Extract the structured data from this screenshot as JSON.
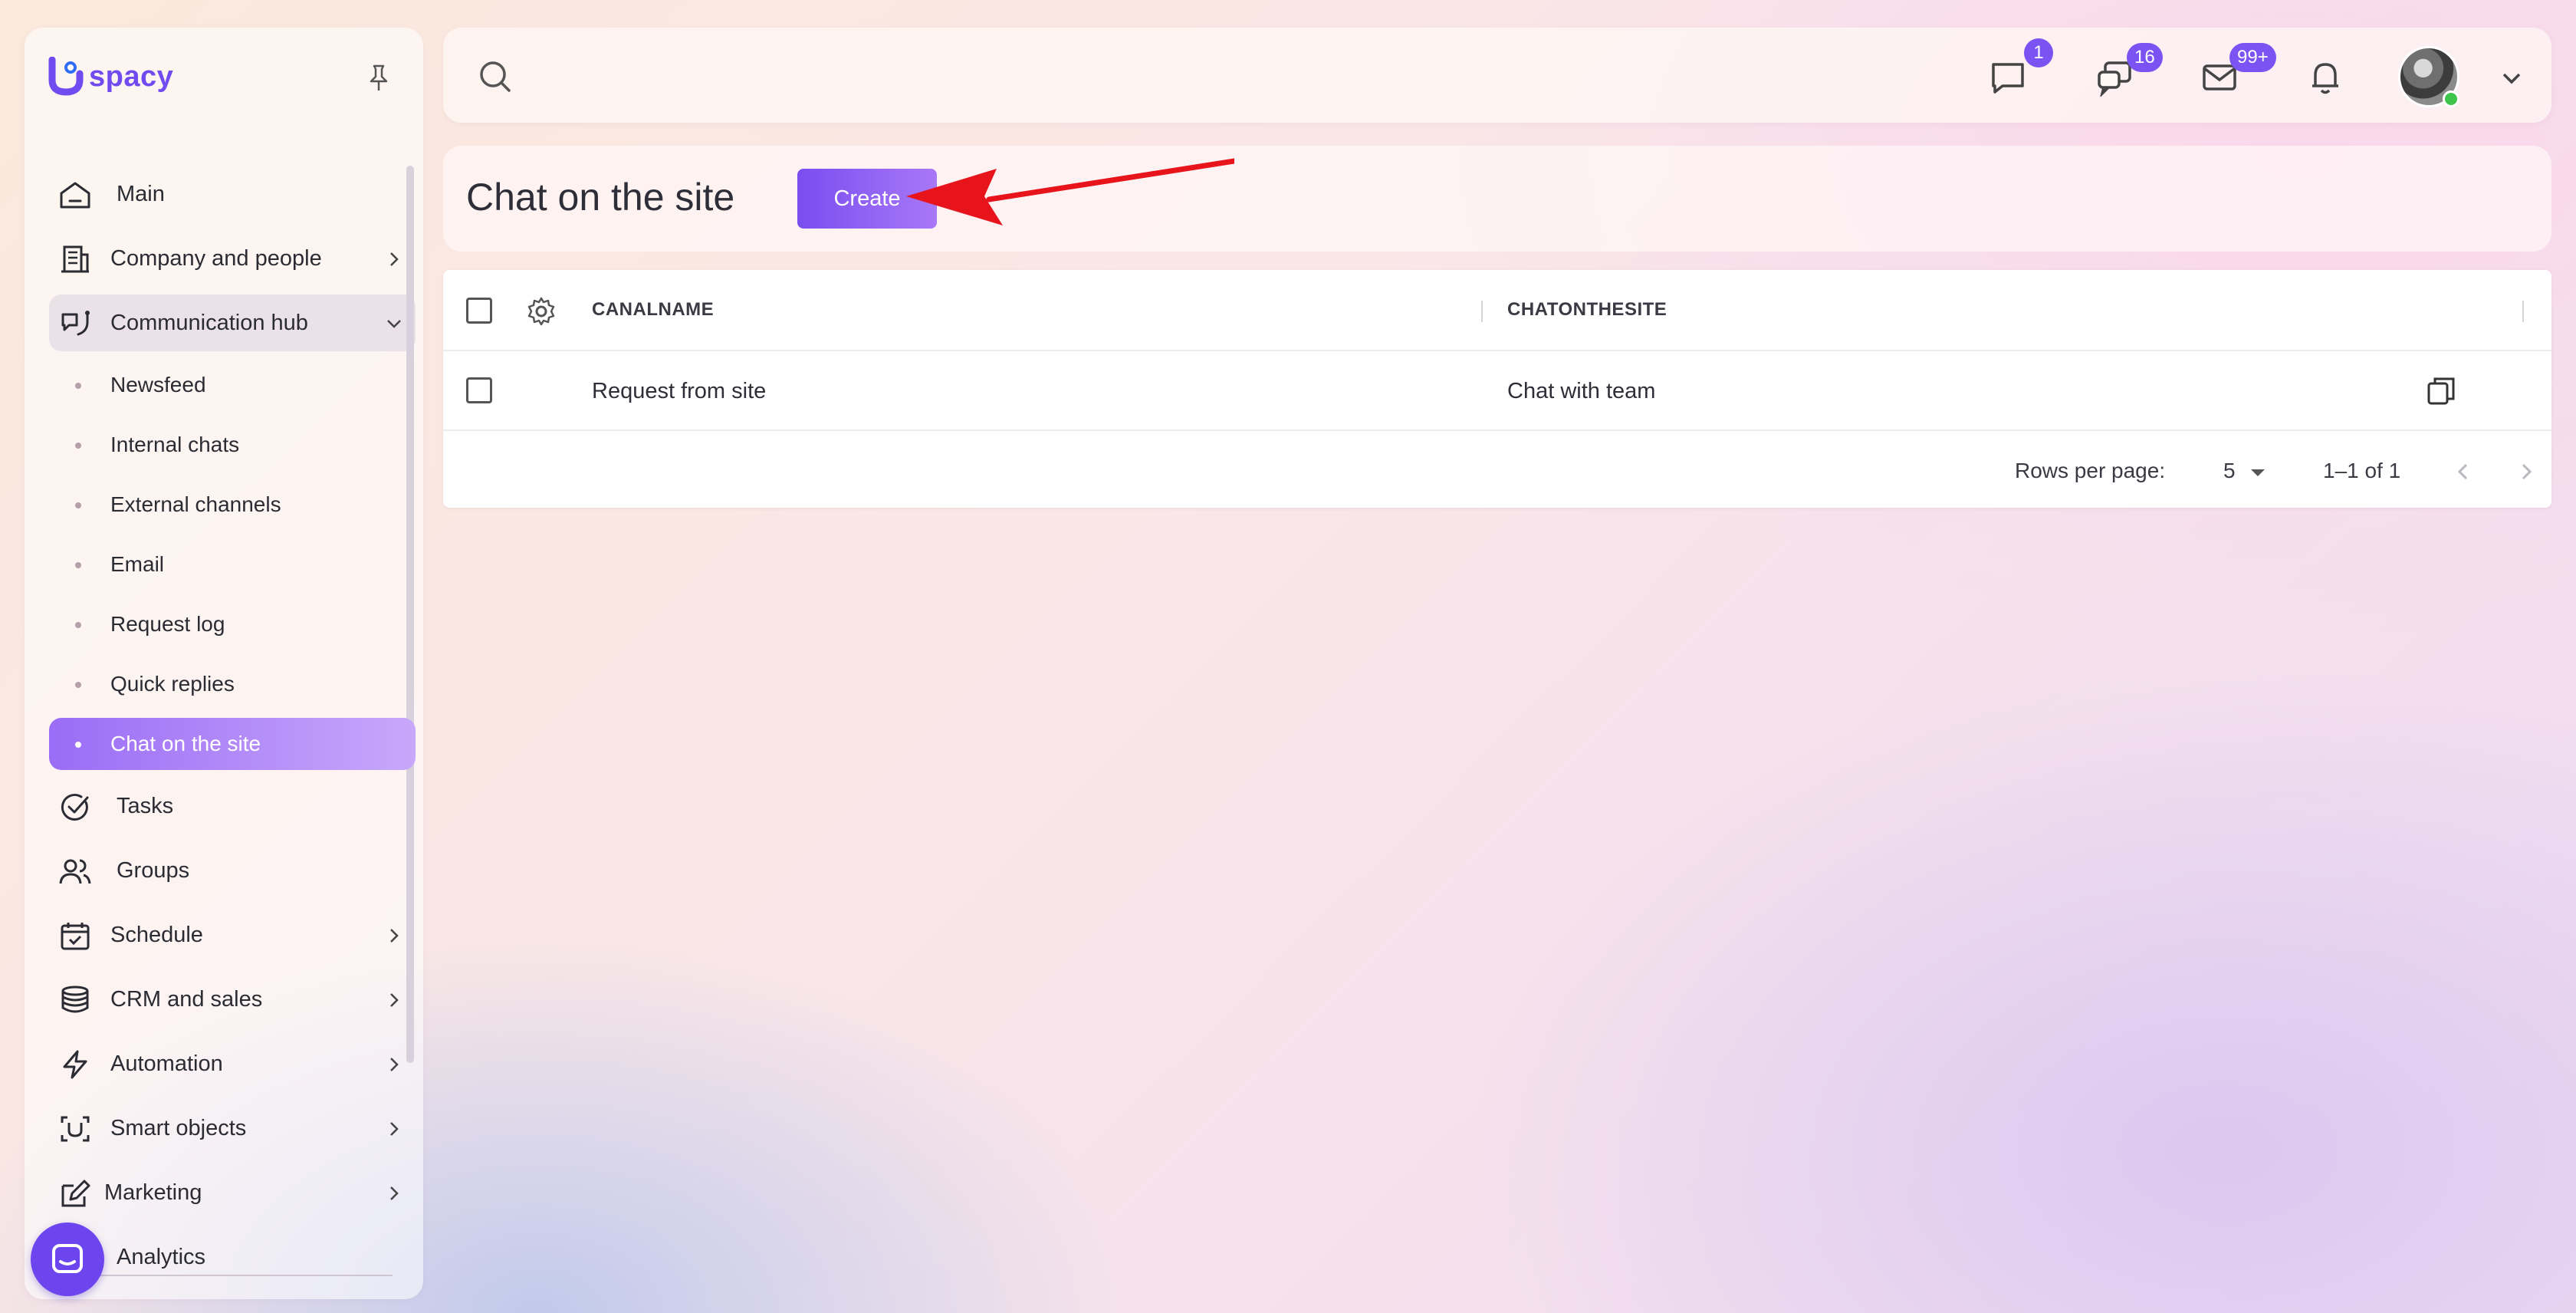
{
  "app": {
    "logo_text": "spacy",
    "logo_letter": "U",
    "brand_color": "#6f4bf0",
    "accent_color": "#7b53f2"
  },
  "sidebar": {
    "items": [
      {
        "label": "Main",
        "icon": "home-icon"
      },
      {
        "label": "Company and people",
        "icon": "building-icon",
        "has_submenu": true
      },
      {
        "label": "Communication hub",
        "icon": "communication-icon",
        "expanded": true
      },
      {
        "label": "Tasks",
        "icon": "task-check-icon"
      },
      {
        "label": "Groups",
        "icon": "groups-icon"
      },
      {
        "label": "Schedule",
        "icon": "calendar-icon",
        "has_submenu": true
      },
      {
        "label": "CRM and sales",
        "icon": "database-icon",
        "has_submenu": true
      },
      {
        "label": "Automation",
        "icon": "lightning-icon",
        "has_submenu": true
      },
      {
        "label": "Smart objects",
        "icon": "smart-object-icon",
        "has_submenu": true
      },
      {
        "label": "Marketing",
        "icon": "marketing-icon",
        "has_submenu": true
      },
      {
        "label": "Analytics",
        "icon": "analytics-icon"
      }
    ],
    "subitems": [
      {
        "label": "Newsfeed"
      },
      {
        "label": "Internal chats"
      },
      {
        "label": "External channels"
      },
      {
        "label": "Email"
      },
      {
        "label": "Request log"
      },
      {
        "label": "Quick replies"
      },
      {
        "label": "Chat on the site",
        "active": true
      }
    ]
  },
  "topbar": {
    "chat_badge": "1",
    "messages_badge": "16",
    "mail_badge": "99+"
  },
  "page": {
    "title": "Chat on the site",
    "create_label": "Create"
  },
  "table": {
    "columns": [
      "CANALNAME",
      "CHATONTHESITE"
    ],
    "rows": [
      {
        "canal_name": "Request from site",
        "chat_on_the_site": "Chat with team"
      }
    ],
    "pagination": {
      "rows_per_page_label": "Rows per page:",
      "rows_per_page": "5",
      "range": "1–1 of 1"
    }
  }
}
